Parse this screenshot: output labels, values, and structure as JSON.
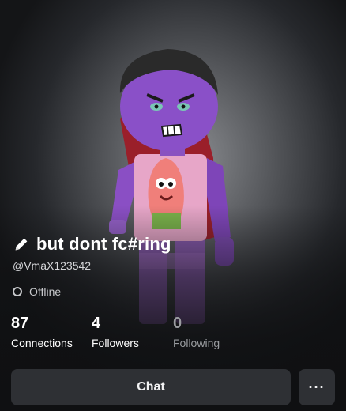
{
  "profile": {
    "display_name": "but dont fc#ring",
    "username": "@VmaX123542",
    "status": "Offline"
  },
  "stats": [
    {
      "value": "87",
      "label": "Connections"
    },
    {
      "value": "4",
      "label": "Followers"
    },
    {
      "value": "0",
      "label": "Following"
    }
  ],
  "actions": {
    "chat_label": "Chat",
    "more_label": "···"
  },
  "icons": {
    "edit": "pencil-icon",
    "status": "offline-ring-icon"
  }
}
